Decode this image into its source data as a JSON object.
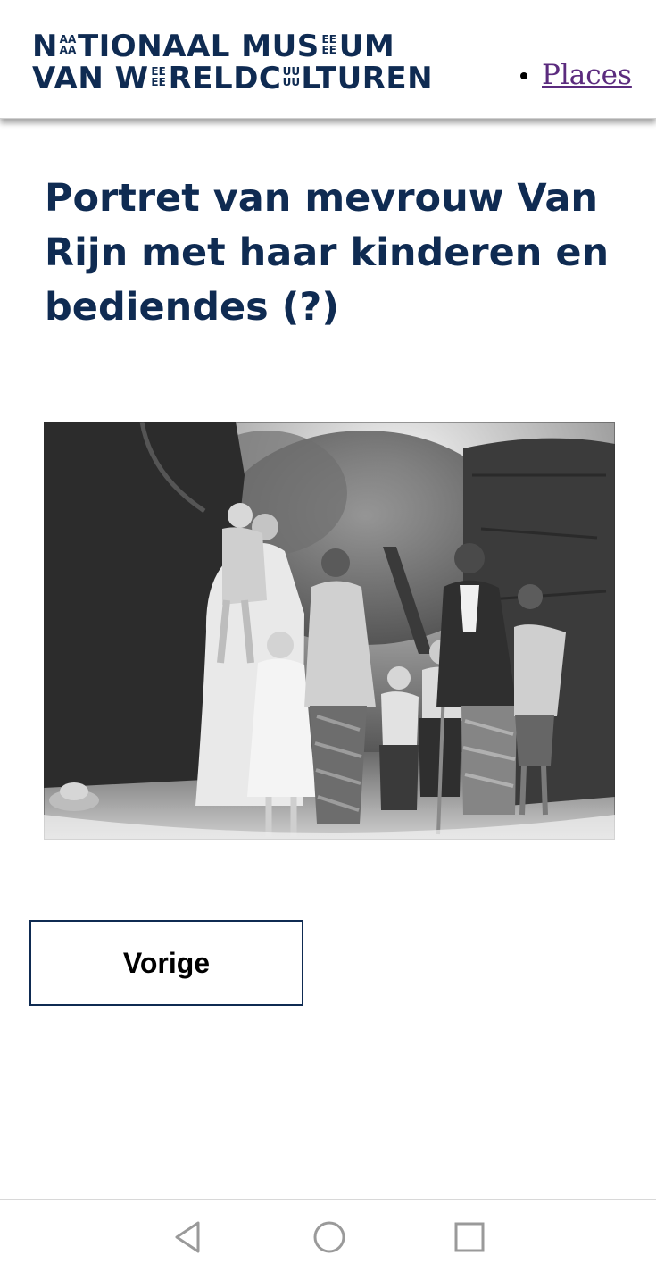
{
  "header": {
    "logo": {
      "line1": {
        "p1": "N",
        "s1": [
          "AA",
          "AA"
        ],
        "p2": "TIONAAL MUS",
        "s2": [
          "EE",
          "EE"
        ],
        "p3": "UM"
      },
      "line2": {
        "p1": "VAN W",
        "s1": [
          "EE",
          "EE"
        ],
        "p2": "RELDC",
        "s2": [
          "UU",
          "UU"
        ],
        "p3": "LTUREN"
      }
    },
    "nav": {
      "items": [
        {
          "label": "Places"
        }
      ]
    }
  },
  "main": {
    "title": "Portret van mevrouw Van Rijn met haar kinderen en bediendes (?)",
    "prev_button_label": "Vorige"
  },
  "colors": {
    "brand_navy": "#0f2b52",
    "visited_link": "#5b2b7e"
  },
  "icons": {
    "system_nav": [
      "back-triangle-icon",
      "home-circle-icon",
      "recents-square-icon"
    ]
  }
}
